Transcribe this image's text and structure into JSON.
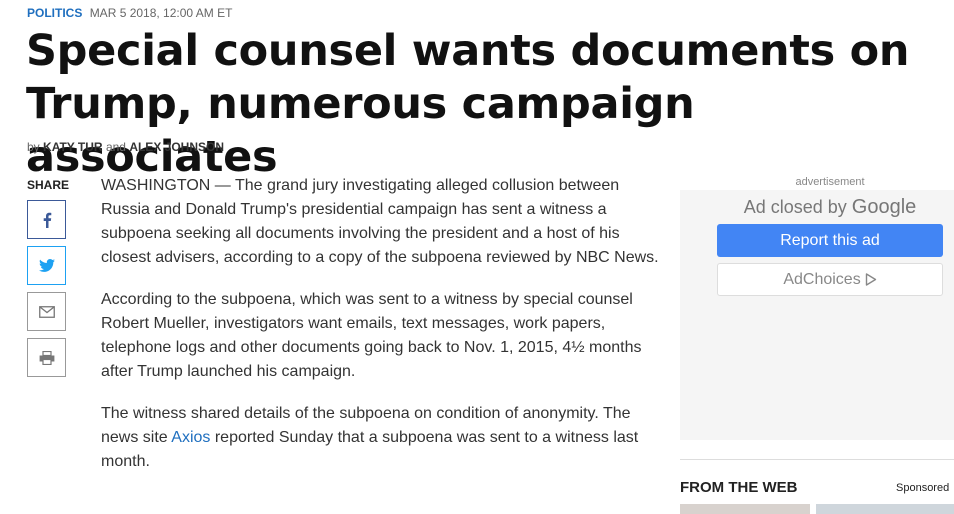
{
  "meta": {
    "section": "POLITICS",
    "date": "MAR 5 2018, 12:00 AM ET"
  },
  "headline": "Special counsel wants documents on Trump, numerous campaign associates",
  "byline": {
    "by": "by",
    "author1": "KATY TUR",
    "and": "and",
    "author2": "ALEX JOHNSON"
  },
  "share": {
    "label": "SHARE",
    "buttons": [
      "facebook-icon",
      "twitter-icon",
      "email-icon",
      "print-icon"
    ]
  },
  "article": {
    "p1": "WASHINGTON — The grand jury investigating alleged collusion between Russia and Donald Trump's presidential campaign has sent a witness a subpoena seeking all documents involving the president and a host of his closest advisers, according to a copy of the subpoena reviewed by NBC News.",
    "p2": "According to the subpoena, which was sent to a witness by special counsel Robert Mueller, investigators want emails, text messages, work papers, telephone logs and other documents going back to Nov. 1, 2015, 4½ months after Trump launched his campaign.",
    "p3_before": "The witness shared details of the subpoena on condition of anonymity. The news site ",
    "p3_link": "Axios",
    "p3_after": " reported Sunday that a subpoena was sent to a witness last month."
  },
  "ad": {
    "label": "advertisement",
    "closed_text": "Ad closed by",
    "brand": "Google",
    "report_label": "Report this ad",
    "adchoices_label": "AdChoices"
  },
  "sidebar": {
    "from_the_web": "FROM THE WEB",
    "sponsored": "Sponsored"
  },
  "colors": {
    "link": "#1f6fbf",
    "report_button": "#4285f4",
    "facebook": "#3b5998",
    "twitter": "#1da1f2"
  }
}
